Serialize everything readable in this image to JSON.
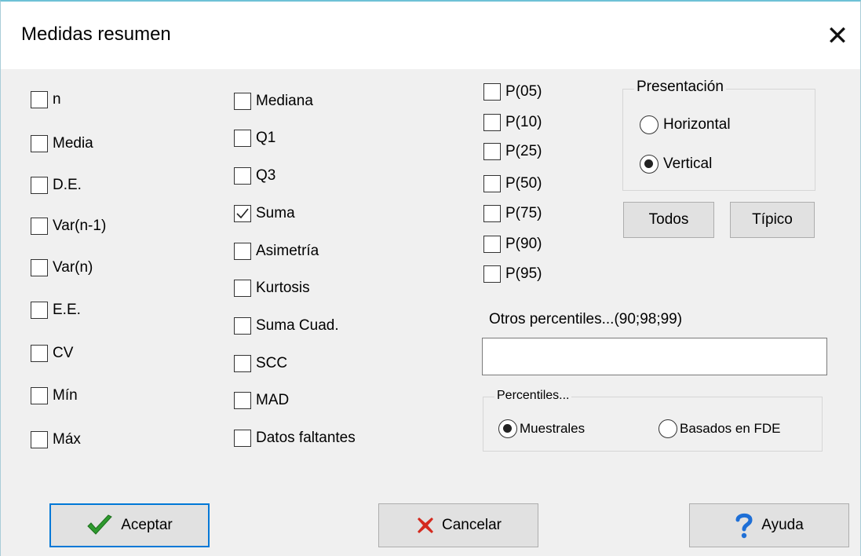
{
  "window": {
    "title": "Medidas resumen",
    "close_glyph": "✕"
  },
  "col1": [
    {
      "label": "n",
      "checked": false
    },
    {
      "label": "Media",
      "checked": false
    },
    {
      "label": "D.E.",
      "checked": false
    },
    {
      "label": "Var(n-1)",
      "checked": false
    },
    {
      "label": "Var(n)",
      "checked": false
    },
    {
      "label": "E.E.",
      "checked": false
    },
    {
      "label": "CV",
      "checked": false
    },
    {
      "label": "Mín",
      "checked": false
    },
    {
      "label": "Máx",
      "checked": false
    }
  ],
  "col2": [
    {
      "label": "Mediana",
      "checked": false
    },
    {
      "label": "Q1",
      "checked": false
    },
    {
      "label": "Q3",
      "checked": false
    },
    {
      "label": "Suma",
      "checked": true
    },
    {
      "label": "Asimetría",
      "checked": false
    },
    {
      "label": "Kurtosis",
      "checked": false
    },
    {
      "label": "Suma Cuad.",
      "checked": false
    },
    {
      "label": "SCC",
      "checked": false
    },
    {
      "label": "MAD",
      "checked": false
    },
    {
      "label": "Datos faltantes",
      "checked": false
    }
  ],
  "col3": [
    {
      "label": "P(05)",
      "checked": false
    },
    {
      "label": "P(10)",
      "checked": false
    },
    {
      "label": "P(25)",
      "checked": false
    },
    {
      "label": "P(50)",
      "checked": false
    },
    {
      "label": "P(75)",
      "checked": false
    },
    {
      "label": "P(90)",
      "checked": false
    },
    {
      "label": "P(95)",
      "checked": false
    }
  ],
  "presentacion": {
    "label": "Presentación",
    "horizontal": "Horizontal",
    "vertical": "Vertical",
    "selected": "vertical"
  },
  "buttons": {
    "todos": "Todos",
    "tipico": "Típico",
    "aceptar": "Aceptar",
    "cancelar": "Cancelar",
    "ayuda": "Ayuda"
  },
  "otros": {
    "label": "Otros percentiles...(90;98;99)",
    "value": ""
  },
  "percentiles": {
    "label": "Percentiles...",
    "muestrales": "Muestrales",
    "fde": "Basados en FDE",
    "selected": "muestrales"
  },
  "icons": {
    "accept": "checkmark-icon",
    "cancel": "x-icon",
    "help": "question-icon"
  },
  "colors": {
    "accept_green": "#2e9a2e",
    "cancel_red": "#d42a1e",
    "help_blue": "#1e6fd6",
    "focus_blue": "#0078d7"
  }
}
